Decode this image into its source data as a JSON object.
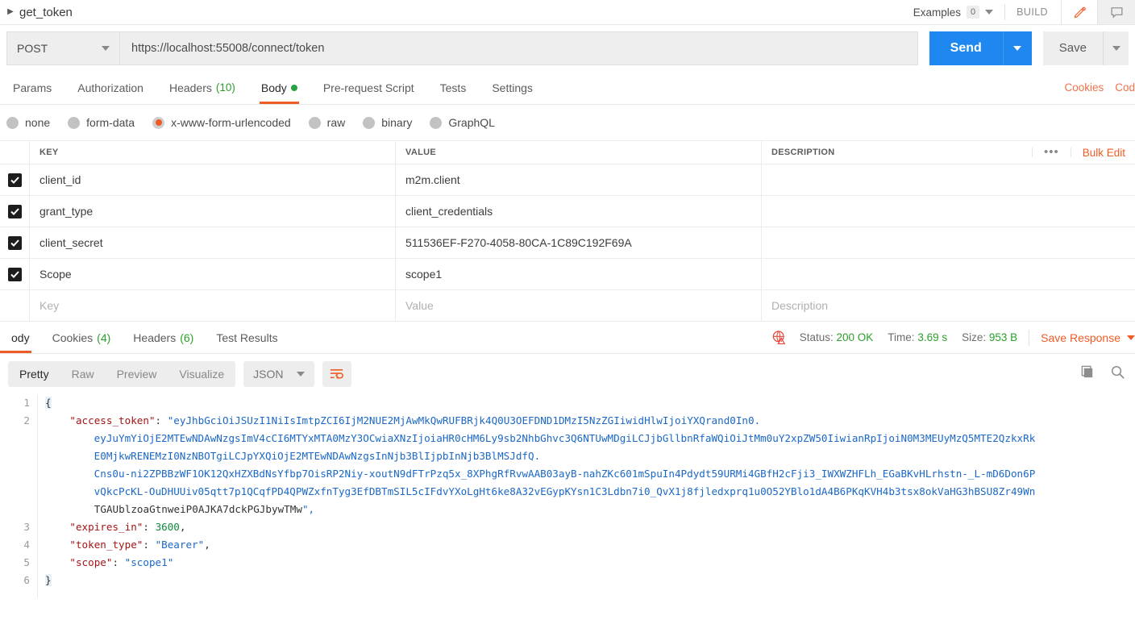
{
  "header": {
    "request_name": "get_token",
    "examples_label": "Examples",
    "examples_count": "0",
    "build_label": "BUILD",
    "edit_icon": "pencil-icon",
    "comment_icon": "comment-icon"
  },
  "url_bar": {
    "method": "POST",
    "url": "https://localhost:55008/connect/token",
    "send_label": "Send",
    "save_label": "Save"
  },
  "request_tabs": [
    {
      "label": "Params",
      "count": "",
      "active": false
    },
    {
      "label": "Authorization",
      "count": "",
      "active": false
    },
    {
      "label": "Headers",
      "count": "(10)",
      "active": false
    },
    {
      "label": "Body",
      "count": "",
      "active": true
    },
    {
      "label": "Pre-request Script",
      "count": "",
      "active": false
    },
    {
      "label": "Tests",
      "count": "",
      "active": false
    },
    {
      "label": "Settings",
      "count": "",
      "active": false
    }
  ],
  "tab_right_links": [
    "Cookies",
    "Cod"
  ],
  "body_types": [
    {
      "label": "none",
      "selected": false
    },
    {
      "label": "form-data",
      "selected": false
    },
    {
      "label": "x-www-form-urlencoded",
      "selected": true
    },
    {
      "label": "raw",
      "selected": false
    },
    {
      "label": "binary",
      "selected": false
    },
    {
      "label": "GraphQL",
      "selected": false
    }
  ],
  "kv_table": {
    "columns": [
      "KEY",
      "VALUE",
      "DESCRIPTION"
    ],
    "bulk_edit_label": "Bulk Edit",
    "more_icon": "more-options-icon",
    "rows": [
      {
        "checked": true,
        "key": "client_id",
        "value": "m2m.client",
        "description": ""
      },
      {
        "checked": true,
        "key": "grant_type",
        "value": "client_credentials",
        "description": ""
      },
      {
        "checked": true,
        "key": "client_secret",
        "value": "511536EF-F270-4058-80CA-1C89C192F69A",
        "description": ""
      },
      {
        "checked": true,
        "key": "Scope",
        "value": "scope1",
        "description": ""
      }
    ],
    "placeholder_row": {
      "key": "Key",
      "value": "Value",
      "description": "Description"
    }
  },
  "response": {
    "tabs": [
      {
        "label": "ody",
        "count": "",
        "active": true
      },
      {
        "label": "Cookies",
        "count": "(4)",
        "active": false
      },
      {
        "label": "Headers",
        "count": "(6)",
        "active": false
      },
      {
        "label": "Test Results",
        "count": "",
        "active": false
      }
    ],
    "warn_icon": "globe-warning-icon",
    "status_label": "Status:",
    "status_value": "200 OK",
    "time_label": "Time:",
    "time_value": "3.69 s",
    "size_label": "Size:",
    "size_value": "953 B",
    "save_response_label": "Save Response",
    "view_modes": [
      {
        "label": "Pretty",
        "active": true
      },
      {
        "label": "Raw",
        "active": false
      },
      {
        "label": "Preview",
        "active": false
      },
      {
        "label": "Visualize",
        "active": false
      }
    ],
    "format": "JSON",
    "wrap_icon": "word-wrap-icon",
    "copy_icon": "copy-icon",
    "search_icon": "search-icon"
  },
  "code": {
    "line_numbers": [
      "1",
      "2",
      "3",
      "4",
      "5",
      "6"
    ],
    "lines": [
      "{",
      "    \"access_token\": \"eyJhbGciOiJSUzI1NiIsImtpZCI6IjM2NUE2MjAwMkQwRUFBRjk4Q0U3OEFDND1DMzI5NzZGIiwidHlwIjoiYXQrand0In0.",
      "        eyJuYmYiOjE2MTEwNDAwNzgsImV4cCI6MTYxMTA0MzY3OCwiaXNzIjoiaHR0cHM6Ly9sb2NhbGhvc3Q6NTUwMDgiLCJjbGllbnRfaWQiOiJtMm0uY2xpZW50IiwianRpIjoiN0M3MEUyMzQ5MTE2QzkxRk",
      "        E0MjkwRENEMzI0NzNBOTgiLCJpYXQiOjE2MTEwNDAwNzgsInNjb3BlIjpbInNjb3BlMSJdfQ.",
      "        Cns0u-ni2ZPBBzWF1OK12QxHZXBdNsYfbp7OisRP2Niy-xoutN9dFTrPzq5x_8XPhgRfRvwAAB03ayB-nahZKc601mSpuIn4Pdydt59URMi4GBfH2cFji3_IWXWZHFLh_EGaBKvHLrhstn-_L-mD6Don6P",
      "        vQkcPcKL-OuDHUUiv05qtt7p1QCqfPD4QPWZxfnTyg3EfDBTmSIL5cIFdvYXoLgHt6ke8A32vEGypKYsn1C3Ldbn7i0_QvX1j8fjledxprq1u0O52YBlo1dA4B6PKqKVH4b3tsx8okVaHG3hBSU8Zr49Wn",
      "        TGAUblzoaGtnweiP0AJKA7dckPGJbywTMw\",",
      "    \"expires_in\": 3600,",
      "    \"token_type\": \"Bearer\",",
      "    \"scope\": \"scope1\"",
      "}"
    ],
    "token_key": "access_token",
    "expires_in_key": "expires_in",
    "expires_in_value": "3600",
    "token_type_key": "token_type",
    "token_type_value": "Bearer",
    "scope_key": "scope",
    "scope_value": "scope1"
  },
  "colors": {
    "accent_orange": "#ef5b25",
    "send_blue": "#1e88f0",
    "success_green": "#2aa02a",
    "string_blue": "#1b68c6",
    "key_red": "#a31515"
  }
}
